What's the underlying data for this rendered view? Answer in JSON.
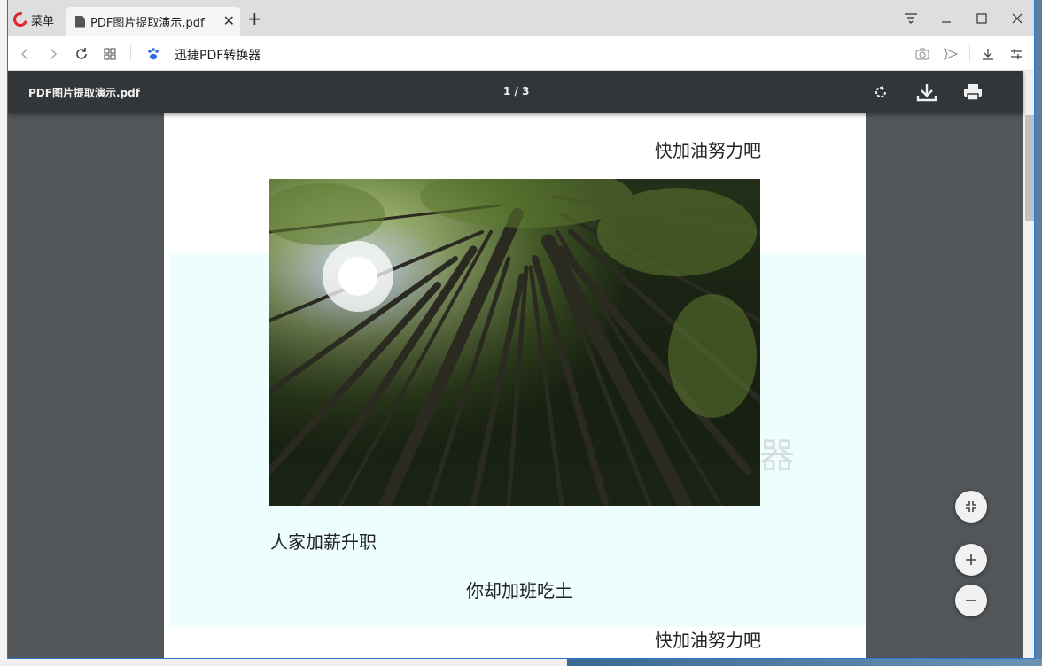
{
  "browser": {
    "menu_label": "菜单",
    "tab_title": "PDF图片提取演示.pdf",
    "new_tab": "+",
    "url_text": "迅捷PDF转换器"
  },
  "viewer": {
    "doc_title": "PDF图片提取演示.pdf",
    "page_indicator": "1 / 3"
  },
  "page": {
    "line_top": "快加油努力吧",
    "line_1": "人家加薪升职",
    "line_2": "你却加班吃土",
    "line_bottom": "快加油努力吧",
    "watermark": "器",
    "image_subject": "bamboo forest looking up"
  },
  "zoom": {
    "fit_label": "fit-to-page",
    "zoom_in": "+",
    "zoom_out": "−"
  },
  "colors": {
    "toolbar": "#323639",
    "viewer_bg": "#525659",
    "tint": "#eefefe",
    "accent": "#e0262c"
  }
}
